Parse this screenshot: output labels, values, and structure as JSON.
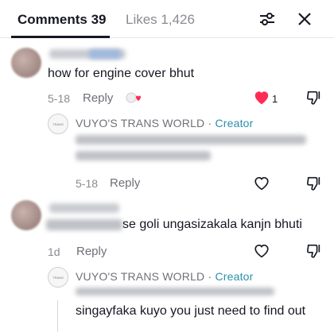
{
  "header": {
    "tab_comments": "Comments 39",
    "tab_likes": "Likes 1,426",
    "filter_icon": "sliders-icon",
    "close_icon": "close-x-icon"
  },
  "comments": [
    {
      "text": "how for engine cover bhut",
      "time": "5-18",
      "reply_label": "Reply",
      "like_count": "1",
      "liked": true,
      "creator_reply_indicator": "heart-by-creator-icon",
      "reply": {
        "author": "VUYO'S TRANS WORLD",
        "separator": "·",
        "badge": "Creator",
        "time": "5-18",
        "reply_label": "Reply"
      }
    },
    {
      "text": "ungasizakala kanjn bhuti",
      "text_prefix_visible": "se goli",
      "time": "1d",
      "reply_label": "Reply",
      "reply": {
        "author": "VUYO'S TRANS WORLD",
        "separator": "·",
        "badge": "Creator",
        "text": "singayfaka kuyo you just need to find out"
      }
    }
  ],
  "colors": {
    "like_active": "#fe2c55",
    "creator_badge": "#2a8fa8",
    "muted": "#8a8b91"
  }
}
